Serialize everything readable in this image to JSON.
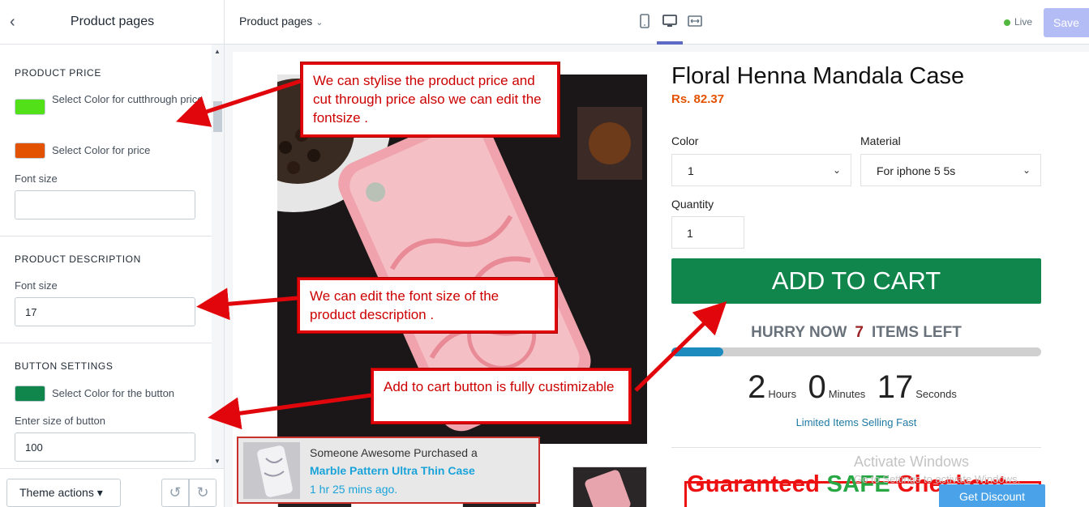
{
  "sidebar": {
    "title": "Product pages",
    "price_section": {
      "heading": "PRODUCT PRICE",
      "cut_color_label": "Select Color for cutthrough price",
      "cut_color": "#52e018",
      "price_color_label": "Select Color for price",
      "price_color": "#e35200",
      "font_size_label": "Font size",
      "font_size_value": ""
    },
    "description_section": {
      "heading": "PRODUCT DESCRIPTION",
      "font_size_label": "Font size",
      "font_size_value": "17"
    },
    "button_section": {
      "heading": "BUTTON SETTINGS",
      "color_label": "Select Color for the button",
      "button_color": "#10864c",
      "size_label": "Enter size of button",
      "size_value": "100"
    },
    "footer": {
      "theme_actions": "Theme actions ▾",
      "undo_icon": "undo-icon",
      "redo_icon": "redo-icon"
    }
  },
  "topbar": {
    "page_select": "Product pages",
    "devices": [
      "mobile-icon",
      "desktop-icon",
      "fullwidth-icon"
    ],
    "active_device": "desktop",
    "status": "Live",
    "status_color": "#50b83c",
    "save_label": "Save"
  },
  "product": {
    "title": "Floral Henna Mandala Case",
    "price": "Rs. 82.37",
    "color_label": "Color",
    "color_value": "1",
    "material_label": "Material",
    "material_value": "For iphone 5 5s",
    "quantity_label": "Quantity",
    "quantity_value": "1",
    "add_to_cart": "ADD TO CART",
    "hurry_prefix": "HURRY NOW",
    "hurry_count": "7",
    "hurry_suffix": "ITEMS LEFT",
    "stock_progress": 0.14,
    "timer": {
      "hours": "2",
      "hours_label": "Hours",
      "minutes": "0",
      "minutes_label": "Minutes",
      "seconds": "17",
      "seconds_label": "Seconds"
    },
    "limited_text": "Limited Items Selling Fast",
    "guarantee_red": "Guaranteed ",
    "guarantee_green": "SAFE",
    "guarantee_rest": " Checkout",
    "get_discount": "Get Discount"
  },
  "popup": {
    "line1": "Someone Awesome Purchased a",
    "product": "Marble Pattern Ultra Thin Case",
    "time": "1 hr 25 mins ago."
  },
  "annotations": {
    "price_note": "We can stylise the product price and cut through price also we can edit the fontsize .",
    "description_note": "We can edit the font size of the product description .",
    "button_note": "Add to cart button is fully custimizable"
  },
  "watermark": {
    "line1": "Activate Windows",
    "line2": "Go to Settings to activate Windows."
  }
}
